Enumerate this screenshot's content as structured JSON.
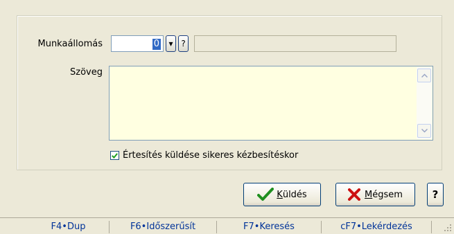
{
  "form": {
    "workstation_label": "Munkaállomás",
    "workstation_value": "0",
    "dropdown_glyph": "▾",
    "help_glyph": "?",
    "workstation_name": "",
    "text_label": "Szöveg",
    "text_value": "",
    "notify_checked": true,
    "notify_label": "Értesítés küldése sikeres kézbesítéskor"
  },
  "buttons": {
    "send_accel": "K",
    "send_rest": "üldés",
    "cancel_accel": "M",
    "cancel_rest": "égsem",
    "help": "?"
  },
  "statusbar": {
    "items": [
      "F4•Dup",
      "F6•Időszerűsít",
      "F7•Keresés",
      "cF7•Lekérdezés"
    ]
  },
  "colors": {
    "text_bg": "#ffffe1",
    "selection": "#316ac5",
    "status_text": "#003399",
    "check_green": "#1f8f1f",
    "cancel_red": "#cc1111"
  },
  "icons": {
    "send": "green-checkmark-icon",
    "cancel": "red-x-icon"
  }
}
